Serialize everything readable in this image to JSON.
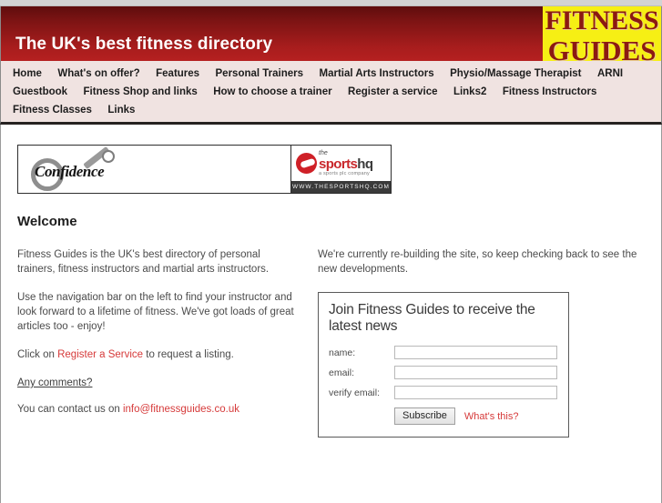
{
  "masthead": {
    "title": "The UK's best fitness directory",
    "logo_line1": "FITNESS",
    "logo_line2": "GUIDES",
    "gradient_top": "#5f0d0d",
    "gradient_bottom": "#b52020",
    "logo_bg": "#f6ef14",
    "logo_fg": "#8b1a11"
  },
  "nav": {
    "background": "#f0e3e1",
    "items": [
      {
        "label": "Home"
      },
      {
        "label": "What's on offer?"
      },
      {
        "label": "Features"
      },
      {
        "label": "Personal Trainers"
      },
      {
        "label": "Martial Arts Instructors"
      },
      {
        "label": "Physio/Massage Therapist"
      },
      {
        "label": "ARNI"
      },
      {
        "label": "Guestbook"
      },
      {
        "label": "Fitness Shop and links"
      },
      {
        "label": "How to choose a trainer"
      },
      {
        "label": "Register a service"
      },
      {
        "label": "Links2"
      },
      {
        "label": "Fitness Instructors"
      },
      {
        "label": "Fitness Classes"
      },
      {
        "label": "Links"
      }
    ]
  },
  "ads": {
    "confidence": {
      "wordmark": "Confidence"
    },
    "sportshq": {
      "the": "the",
      "sports": "sports",
      "hq": "hq",
      "tagline": "a sports plc company",
      "url": "WWW.THESPORTSHQ.COM"
    }
  },
  "main": {
    "heading": "Welcome",
    "left": {
      "p1": "Fitness Guides is the UK's best directory of personal trainers, fitness instructors and martial arts instructors.",
      "p2": "Use the navigation bar on the left to find your instructor and look forward to a lifetime of fitness. We've got loads of great articles too - enjoy!",
      "p3_before": "Click on ",
      "p3_link": "Register a Service",
      "p3_after": " to request a listing.",
      "comments_link": "Any comments?",
      "p4_before": "You can contact us on ",
      "p4_email": "info@fitnessguides.co.uk"
    },
    "right": {
      "p1": "We're currently re-building the site, so keep checking back to see the new developments."
    }
  },
  "signup": {
    "heading": "Join Fitness Guides to receive the latest news",
    "fields": [
      {
        "label": "name:",
        "value": "",
        "placeholder": ""
      },
      {
        "label": "email:",
        "value": "",
        "placeholder": ""
      },
      {
        "label": "verify email:",
        "value": "",
        "placeholder": ""
      }
    ],
    "submit_label": "Subscribe",
    "help_link": "What's this?",
    "link_color": "#d63a3a"
  }
}
